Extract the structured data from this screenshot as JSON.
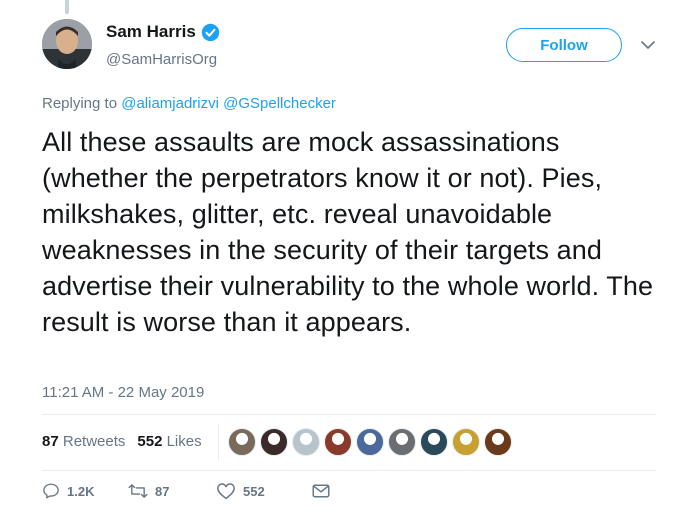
{
  "author": {
    "display_name": "Sam Harris",
    "handle": "@SamHarrisOrg",
    "verified": true
  },
  "follow_label": "Follow",
  "reply_context": {
    "prefix": "Replying to",
    "mentions": [
      "@aliamjadrizvi",
      "@GSpellchecker"
    ]
  },
  "tweet_text": "All these assaults are mock assassinations (whether the perpetrators know it or not). Pies, milkshakes, glitter, etc. reveal unavoidable weaknesses in the security of their targets and advertise their vulnerability to the whole world. The result is worse than it appears.",
  "timestamp": "11:21 AM - 22 May 2019",
  "stats": {
    "retweets_count": "87",
    "retweets_label": "Retweets",
    "likes_count": "552",
    "likes_label": "Likes"
  },
  "liker_avatars": [
    "#7a6a5a",
    "#3a2a2a",
    "#b8c4cc",
    "#8a3a2a",
    "#4a6a9a",
    "#6a6e72",
    "#2a4a5a",
    "#c8a030",
    "#6a3a1a"
  ],
  "actions": {
    "reply_count": "1.2K",
    "retweet_count": "87",
    "like_count": "552"
  },
  "colors": {
    "accent": "#1da1f2",
    "muted": "#657786",
    "text": "#14171a"
  }
}
